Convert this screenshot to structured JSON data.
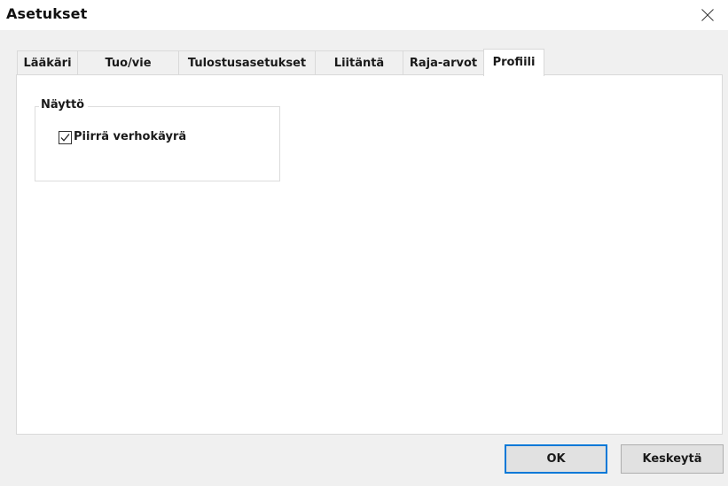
{
  "window": {
    "title": "Asetukset"
  },
  "tabs": [
    {
      "label": "Lääkäri",
      "active": false
    },
    {
      "label": "Tuo/vie",
      "active": false
    },
    {
      "label": "Tulostusasetukset",
      "active": false
    },
    {
      "label": "Liitäntä",
      "active": false
    },
    {
      "label": "Raja-arvot",
      "active": false
    },
    {
      "label": "Profiili",
      "active": true
    }
  ],
  "display_group": {
    "legend": "Näyttö",
    "curtain_curve_checkbox": {
      "label": "Piirrä verhokäyrä",
      "checked": true
    }
  },
  "buttons": {
    "ok_label": "OK",
    "cancel_label": "Keskeytä"
  },
  "colors": {
    "dialog_background": "#f0f0f0",
    "panel_background": "#ffffff",
    "default_button_border": "#0078d7"
  },
  "icons": {
    "close": "close-icon",
    "check": "checkmark-icon"
  }
}
